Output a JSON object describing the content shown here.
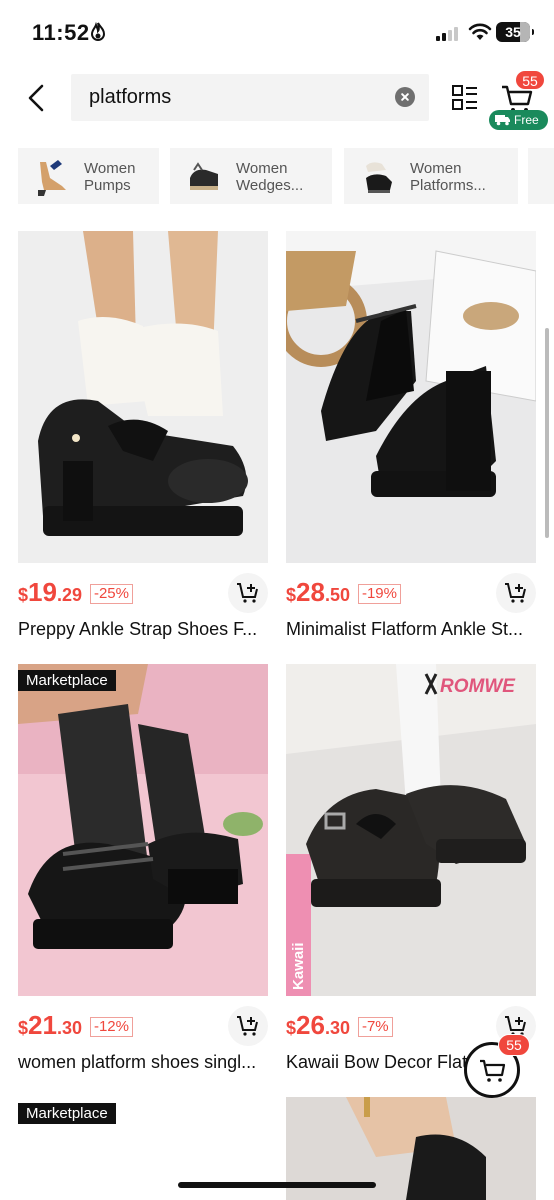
{
  "status_bar": {
    "time": "11:52",
    "battery": "35"
  },
  "search": {
    "query": "platforms"
  },
  "header": {
    "cart_count": "55",
    "free_label": "Free"
  },
  "categories": [
    {
      "label": "Women\nPumps",
      "icon": "pumps-thumbnail"
    },
    {
      "label": "Women\nWedges...",
      "icon": "wedges-thumbnail"
    },
    {
      "label": "Women\nPlatforms...",
      "icon": "platforms-thumbnail"
    }
  ],
  "products": [
    {
      "currency": "$",
      "price_int": "19",
      "price_dec": ".29",
      "discount": "-25%",
      "title": "Preppy Ankle Strap Shoes F...",
      "tag": ""
    },
    {
      "currency": "$",
      "price_int": "28",
      "price_dec": ".50",
      "discount": "-19%",
      "title": "Minimalist Flatform Ankle St...",
      "tag": ""
    },
    {
      "currency": "$",
      "price_int": "21",
      "price_dec": ".30",
      "discount": "-12%",
      "title": "women platform shoes singl...",
      "tag": "Marketplace"
    },
    {
      "currency": "$",
      "price_int": "26",
      "price_dec": ".30",
      "discount": "-7%",
      "title": "Kawaii Bow Decor Flat...",
      "tag": "",
      "brand_text": "ROMWE",
      "side_text": "Kawaii"
    },
    {
      "tag": "Marketplace"
    }
  ],
  "floating_cart": {
    "count": "55"
  },
  "colors": {
    "price": "#f0473d",
    "free_badge": "#1a8a5c"
  }
}
